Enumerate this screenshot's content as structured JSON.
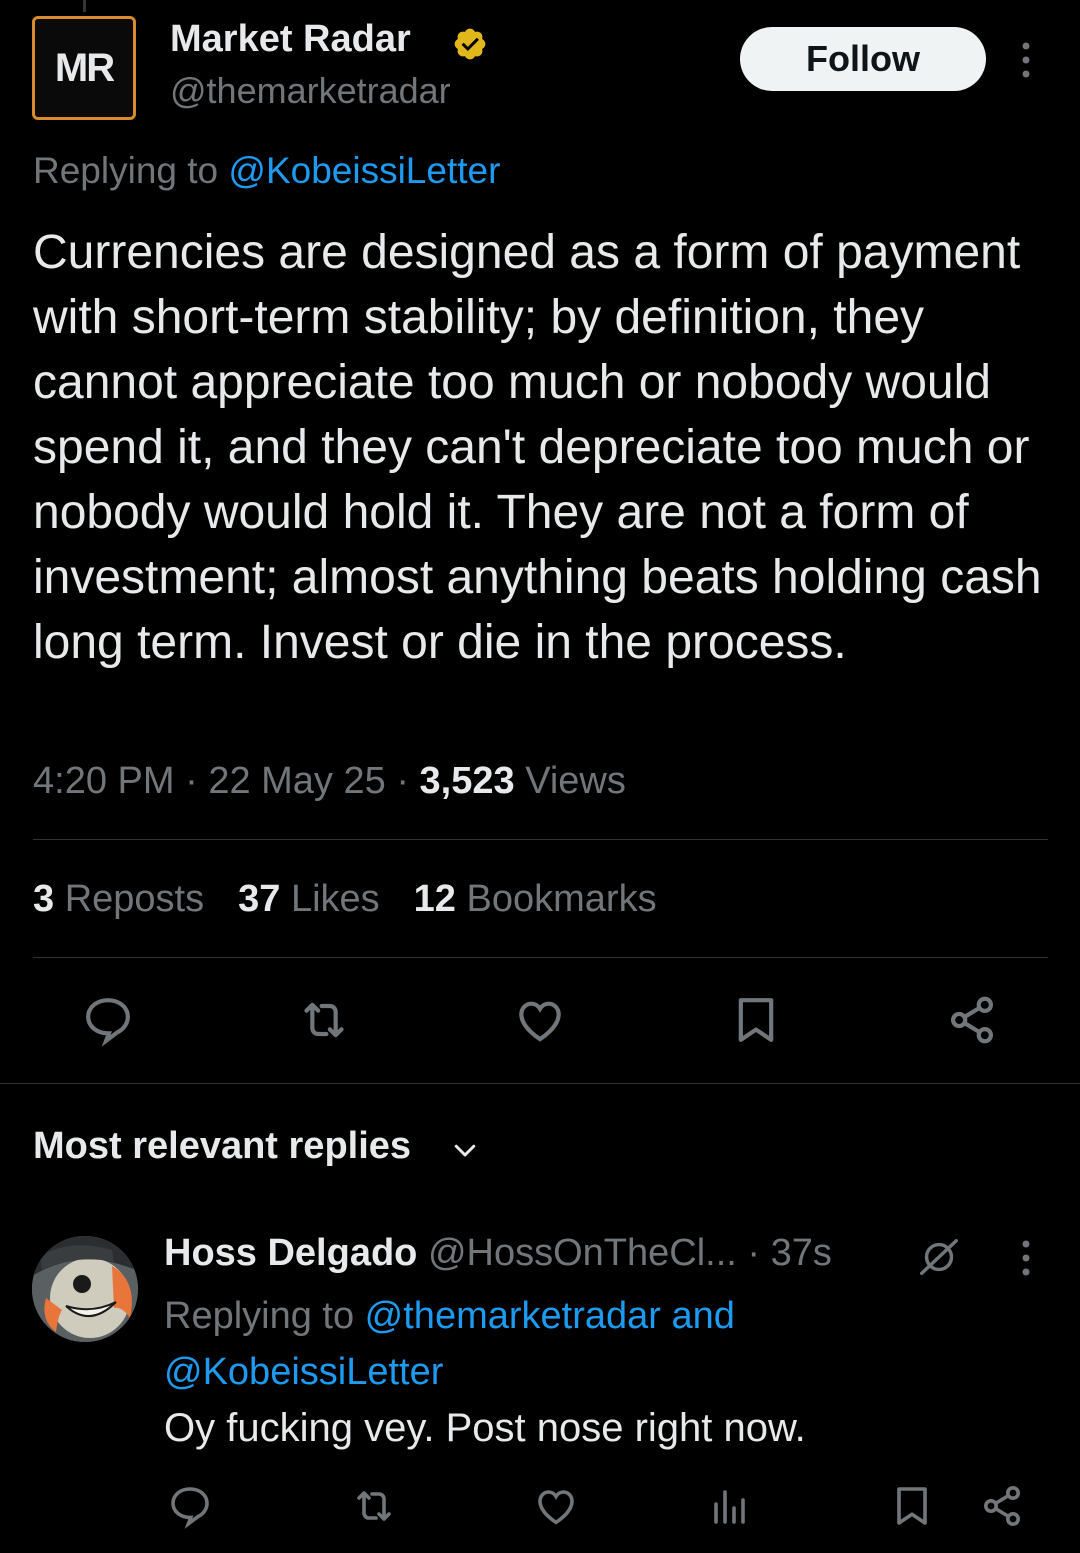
{
  "author": {
    "display_name": "Market Radar",
    "handle": "@themarketradar",
    "avatar_text": "MR",
    "follow_label": "Follow"
  },
  "tweet": {
    "replying_prefix": "Replying to ",
    "replying_to": "@KobeissiLetter",
    "text": "Currencies are designed as a form of payment with short-term stability; by definition, they cannot appreciate too much or nobody would spend it, and they can't depreciate too much or nobody would hold it. They are not a form of investment; almost anything beats holding cash long term. Invest or die in the process.",
    "time": "4:20 PM",
    "date": "22 May 25",
    "views_count": "3,523",
    "views_label": " Views"
  },
  "stats": {
    "reposts_count": "3",
    "reposts_label": " Reposts",
    "likes_count": "37",
    "likes_label": " Likes",
    "bookmarks_count": "12",
    "bookmarks_label": " Bookmarks"
  },
  "icons": {
    "actions": [
      "reply-icon",
      "repost-icon",
      "like-icon",
      "bookmark-icon",
      "share-icon"
    ],
    "reply_actions": [
      "reply-icon",
      "repost-icon",
      "like-icon",
      "views-icon",
      "bookmark-icon",
      "share-icon"
    ]
  },
  "replies_section": {
    "title": "Most relevant replies"
  },
  "reply": {
    "display_name": "Hoss Delgado",
    "handle": "@HossOnTheCl...",
    "time": "37s",
    "replying_prefix": "Replying to ",
    "replying_to_1": "@themarketradar",
    "replying_and": " and ",
    "replying_to_2": "@KobeissiLetter",
    "text": "Oy fucking vey. Post nose right now."
  },
  "colors": {
    "background": "#000000",
    "text_primary": "#e7e9ea",
    "text_secondary": "#71767b",
    "link": "#1d9bf0",
    "divider": "#2f3336",
    "verified": "#e2b719",
    "avatar_border": "#d98a2e"
  }
}
